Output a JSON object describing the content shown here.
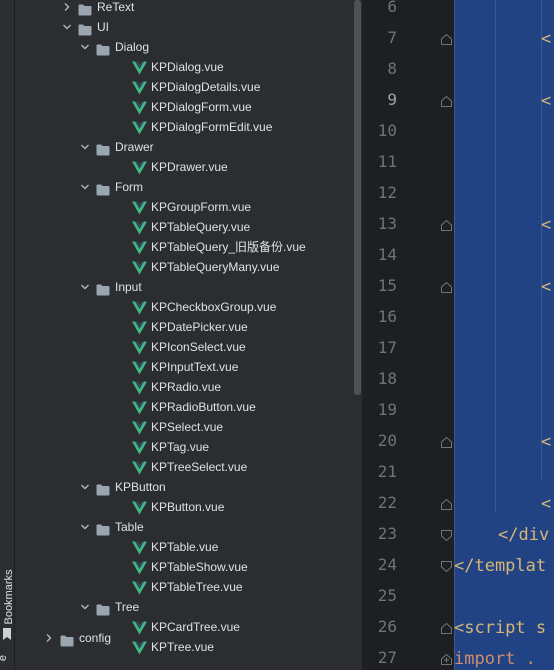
{
  "sidebar": {
    "bookmarks_label": "Bookmarks",
    "bottom_letter": "e"
  },
  "tree": [
    {
      "label": "ReText",
      "kind": "folder",
      "depth": 0,
      "expanded": false
    },
    {
      "label": "UI",
      "kind": "folder",
      "depth": 0,
      "expanded": true
    },
    {
      "label": "Dialog",
      "kind": "folder",
      "depth": 1,
      "expanded": true
    },
    {
      "label": "KPDialog.vue",
      "kind": "vue",
      "depth": 2
    },
    {
      "label": "KPDialogDetails.vue",
      "kind": "vue",
      "depth": 2
    },
    {
      "label": "KPDialogForm.vue",
      "kind": "vue",
      "depth": 2
    },
    {
      "label": "KPDialogFormEdit.vue",
      "kind": "vue",
      "depth": 2
    },
    {
      "label": "Drawer",
      "kind": "folder",
      "depth": 1,
      "expanded": true
    },
    {
      "label": "KPDrawer.vue",
      "kind": "vue",
      "depth": 2
    },
    {
      "label": "Form",
      "kind": "folder",
      "depth": 1,
      "expanded": true
    },
    {
      "label": "KPGroupForm.vue",
      "kind": "vue",
      "depth": 2
    },
    {
      "label": "KPTableQuery.vue",
      "kind": "vue",
      "depth": 2
    },
    {
      "label": "KPTableQuery_旧版备份.vue",
      "kind": "vue",
      "depth": 2
    },
    {
      "label": "KPTableQueryMany.vue",
      "kind": "vue",
      "depth": 2
    },
    {
      "label": "Input",
      "kind": "folder",
      "depth": 1,
      "expanded": true
    },
    {
      "label": "KPCheckboxGroup.vue",
      "kind": "vue",
      "depth": 2
    },
    {
      "label": "KPDatePicker.vue",
      "kind": "vue",
      "depth": 2
    },
    {
      "label": "KPIconSelect.vue",
      "kind": "vue",
      "depth": 2
    },
    {
      "label": "KPInputText.vue",
      "kind": "vue",
      "depth": 2
    },
    {
      "label": "KPRadio.vue",
      "kind": "vue",
      "depth": 2
    },
    {
      "label": "KPRadioButton.vue",
      "kind": "vue",
      "depth": 2
    },
    {
      "label": "KPSelect.vue",
      "kind": "vue",
      "depth": 2
    },
    {
      "label": "KPTag.vue",
      "kind": "vue",
      "depth": 2
    },
    {
      "label": "KPTreeSelect.vue",
      "kind": "vue",
      "depth": 2
    },
    {
      "label": "KPButton",
      "kind": "folder",
      "depth": 1,
      "expanded": true
    },
    {
      "label": "KPButton.vue",
      "kind": "vue",
      "depth": 2
    },
    {
      "label": "Table",
      "kind": "folder",
      "depth": 1,
      "expanded": true
    },
    {
      "label": "KPTable.vue",
      "kind": "vue",
      "depth": 2
    },
    {
      "label": "KPTableShow.vue",
      "kind": "vue",
      "depth": 2
    },
    {
      "label": "KPTableTree.vue",
      "kind": "vue",
      "depth": 2
    },
    {
      "label": "Tree",
      "kind": "folder",
      "depth": 1,
      "expanded": true
    },
    {
      "label": "KPCardTree.vue",
      "kind": "vue",
      "depth": 2
    },
    {
      "label": "KPTree.vue",
      "kind": "vue",
      "depth": 2
    },
    {
      "label": "config",
      "kind": "folder",
      "depth": -1,
      "expanded": false
    }
  ],
  "editor": {
    "line_numbers": [
      "6",
      "7",
      "8",
      "9",
      "10",
      "11",
      "12",
      "13",
      "14",
      "15",
      "16",
      "17",
      "18",
      "19",
      "20",
      "21",
      "22",
      "23",
      "24",
      "25",
      "26",
      "27"
    ],
    "active_line": "9",
    "code_lines": [
      {
        "line": "7",
        "text": "<"
      },
      {
        "line": "9",
        "text": "<"
      },
      {
        "line": "13",
        "text": "<"
      },
      {
        "line": "15",
        "text": "<"
      },
      {
        "line": "20",
        "text": "<"
      },
      {
        "line": "22",
        "text": "<"
      },
      {
        "line": "23",
        "text": "</div"
      },
      {
        "line": "24",
        "text": "</templat"
      },
      {
        "line": "26",
        "text": "<script s"
      },
      {
        "line": "27",
        "text": "import ."
      }
    ]
  },
  "colors": {
    "vue_green": "#41b883",
    "vue_dark": "#34495e",
    "folder": "#9aa7b0",
    "selection": "#214283",
    "tag": "#d5b778",
    "keyword": "#cf8e6d"
  }
}
